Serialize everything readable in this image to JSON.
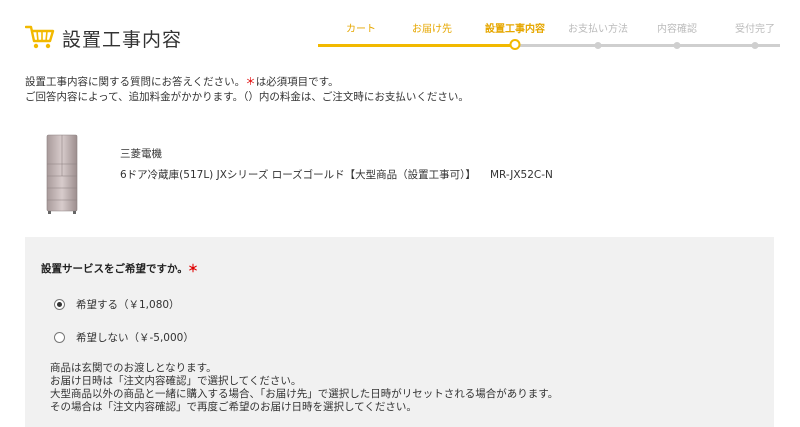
{
  "header": {
    "title": "設置工事内容",
    "icon": "shopping-cart-icon",
    "accent_color": "#f2b900"
  },
  "steps": [
    {
      "label": "カート",
      "state": "done"
    },
    {
      "label": "お届け先",
      "state": "done"
    },
    {
      "label": "設置工事内容",
      "state": "current"
    },
    {
      "label": "お支払い方法",
      "state": "todo"
    },
    {
      "label": "内容確認",
      "state": "todo"
    },
    {
      "label": "受付完了",
      "state": "todo"
    }
  ],
  "intro": {
    "line1_a": "設置工事内容に関する質問にお答えください。",
    "required_mark": "＊",
    "line1_b": "は必須項目です。",
    "line2": "ご回答内容によって、追加料金がかかります。（）内の料金は、ご注文時にお支払いください。"
  },
  "product": {
    "maker": "三菱電機",
    "name": "6ドア冷蔵庫(517L) JXシリーズ ローズゴールド【大型商品（設置工事可）】",
    "model": "MR-JX52C-N"
  },
  "question": {
    "label": "設置サービスをご希望ですか。",
    "required_mark": "＊",
    "options": [
      {
        "label": "希望する（￥1,080）",
        "selected": true
      },
      {
        "label": "希望しない（￥-5,000）",
        "selected": false
      }
    ],
    "notes": [
      "商品は玄関でのお渡しとなります。",
      "お届け日時は「注文内容確認」で選択してください。",
      "大型商品以外の商品と一緒に購入する場合、「お届け先」で選択した日時がリセットされる場合があります。",
      "その場合は「注文内容確認」で再度ご希望のお届け日時を選択してください。"
    ]
  }
}
